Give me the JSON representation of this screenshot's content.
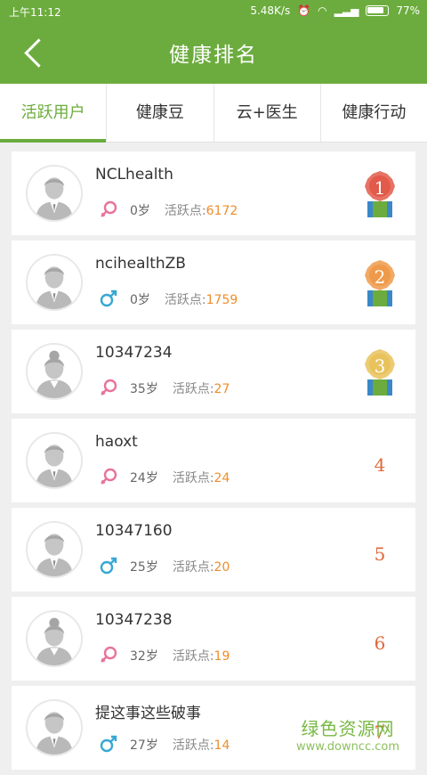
{
  "status": {
    "time": "上午11:12",
    "speed": "5.48K/s",
    "battery": "77%"
  },
  "header": {
    "title": "健康排名"
  },
  "tabs": [
    {
      "label": "活跃用户"
    },
    {
      "label": "健康豆"
    },
    {
      "label": "云+医生"
    },
    {
      "label": "健康行动"
    }
  ],
  "active_tab": 0,
  "users": [
    {
      "name": "NCLhealth",
      "gender": "female",
      "age": "0岁",
      "pts_label": "活跃点:",
      "pts": "6172",
      "rank": "1",
      "medal_color": "#e25a4a"
    },
    {
      "name": "ncihealthZB",
      "gender": "male",
      "age": "0岁",
      "pts_label": "活跃点:",
      "pts": "1759",
      "rank": "2",
      "medal_color": "#ef9a4a"
    },
    {
      "name": "10347234",
      "gender": "female",
      "avatar": "woman",
      "age": "35岁",
      "pts_label": "活跃点:",
      "pts": "27",
      "rank": "3",
      "medal_color": "#e9c25c"
    },
    {
      "name": "haoxt",
      "gender": "female",
      "age": "24岁",
      "pts_label": "活跃点:",
      "pts": "24",
      "rank": "4"
    },
    {
      "name": "10347160",
      "gender": "male",
      "age": "25岁",
      "pts_label": "活跃点:",
      "pts": "20",
      "rank": "5"
    },
    {
      "name": "10347238",
      "gender": "female",
      "avatar": "woman",
      "age": "32岁",
      "pts_label": "活跃点:",
      "pts": "19",
      "rank": "6"
    },
    {
      "name": "提这事这些破事",
      "gender": "male",
      "age": "27岁",
      "pts_label": "活跃点:",
      "pts": "14",
      "rank": "7"
    }
  ],
  "watermark": {
    "line1": "绿色资源网",
    "line2": "www.downcc.com"
  },
  "colors": {
    "brand": "#6cac3e",
    "female": "#e8739a",
    "male": "#37a8d3",
    "points": "#f08c2a",
    "rank": "#e2673a"
  }
}
